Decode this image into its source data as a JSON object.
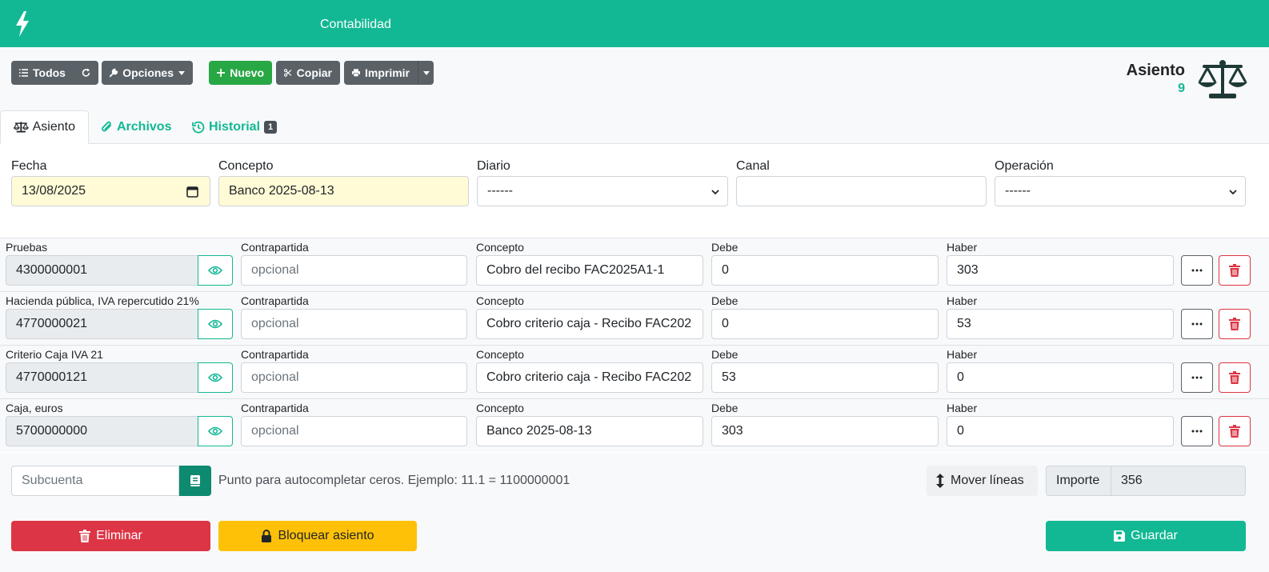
{
  "topbar": {
    "title": "Contabilidad"
  },
  "toolbar": {
    "todos": "Todos",
    "opciones": "Opciones",
    "nuevo": "Nuevo",
    "copiar": "Copiar",
    "imprimir": "Imprimir"
  },
  "header": {
    "label": "Asiento",
    "number": "9"
  },
  "tabs": [
    {
      "label": "Asiento"
    },
    {
      "label": "Archivos"
    },
    {
      "label": "Historial",
      "badge": "1"
    }
  ],
  "form": {
    "fecha": {
      "label": "Fecha",
      "value": "13/08/2025"
    },
    "concepto": {
      "label": "Concepto",
      "value": "Banco 2025-08-13"
    },
    "diario": {
      "label": "Diario",
      "value": "------"
    },
    "canal": {
      "label": "Canal",
      "value": ""
    },
    "operacion": {
      "label": "Operación",
      "value": "------"
    }
  },
  "lines": [
    {
      "account_label": "Pruebas",
      "subcuenta": "4300000001",
      "contrapartida_label": "Contrapartida",
      "contrapartida_placeholder": "opcional",
      "concepto_label": "Concepto",
      "concepto": "Cobro del recibo FAC2025A1-1",
      "debe_label": "Debe",
      "debe": "0",
      "haber_label": "Haber",
      "haber": "303"
    },
    {
      "account_label": "Hacienda pública, IVA repercutido 21%",
      "subcuenta": "4770000021",
      "contrapartida_label": "Contrapartida",
      "contrapartida_placeholder": "opcional",
      "concepto_label": "Concepto",
      "concepto": "Cobro criterio caja - Recibo FAC202",
      "debe_label": "Debe",
      "debe": "0",
      "haber_label": "Haber",
      "haber": "53"
    },
    {
      "account_label": "Criterio Caja IVA 21",
      "subcuenta": "4770000121",
      "contrapartida_label": "Contrapartida",
      "contrapartida_placeholder": "opcional",
      "concepto_label": "Concepto",
      "concepto": "Cobro criterio caja - Recibo FAC202",
      "debe_label": "Debe",
      "debe": "53",
      "haber_label": "Haber",
      "haber": "0"
    },
    {
      "account_label": "Caja, euros",
      "subcuenta": "5700000000",
      "contrapartida_label": "Contrapartida",
      "contrapartida_placeholder": "opcional",
      "concepto_label": "Concepto",
      "concepto": "Banco 2025-08-13",
      "debe_label": "Debe",
      "debe": "303",
      "haber_label": "Haber",
      "haber": "0"
    }
  ],
  "footer": {
    "subcuenta_placeholder": "Subcuenta",
    "hint": "Punto para autocompletar ceros. Ejemplo: 11.1 = 1100000001",
    "mover_lineas": "Mover líneas",
    "importe_label": "Importe",
    "importe_value": "356",
    "eliminar": "Eliminar",
    "bloquear": "Bloquear asiento",
    "guardar": "Guardar"
  },
  "colors": {
    "brand": "#12b894",
    "danger": "#dc3545",
    "warning": "#ffc107",
    "success": "#28a745"
  }
}
